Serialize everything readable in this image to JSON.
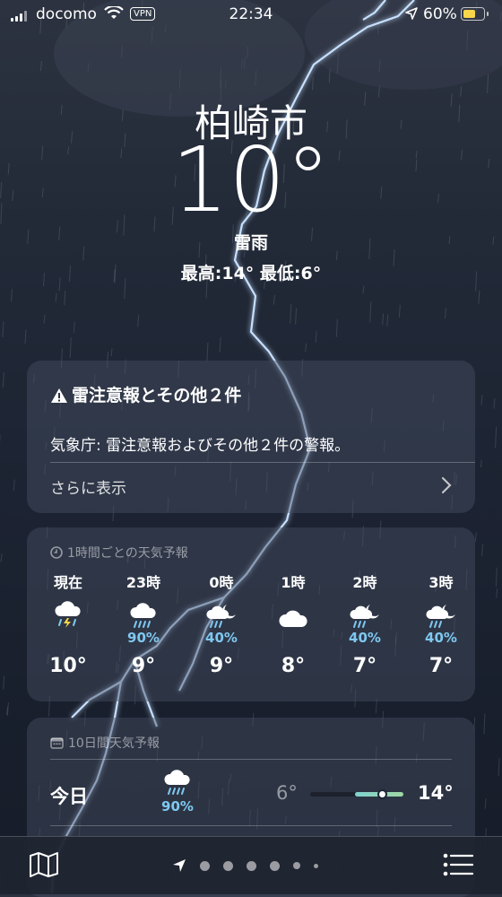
{
  "status_bar": {
    "carrier": "docomo",
    "vpn_label": "VPN",
    "time": "22:34",
    "battery_percent": "60%",
    "battery_level": 0.6,
    "battery_color": "#f7d64a"
  },
  "weather": {
    "city": "柏崎市",
    "temperature": "10°",
    "condition": "雷雨",
    "hi_lo": "最高:14°  最低:6°"
  },
  "alert": {
    "title": "雷注意報とその他２件",
    "body": "気象庁: 雷注意報およびその他２件の警報。",
    "more": "さらに表示"
  },
  "hourly": {
    "header": "1時間ごとの天気予報",
    "items": [
      {
        "label": "現在",
        "icon": "thunderstorm-rain-icon",
        "precip": "",
        "temp": "10°"
      },
      {
        "label": "23時",
        "icon": "cloud-rain-icon",
        "precip": "90%",
        "temp": "9°"
      },
      {
        "label": "0時",
        "icon": "cloud-moon-rain-icon",
        "precip": "40%",
        "temp": "9°"
      },
      {
        "label": "1時",
        "icon": "cloud-icon",
        "precip": "",
        "temp": "8°"
      },
      {
        "label": "2時",
        "icon": "cloud-moon-rain-icon",
        "precip": "40%",
        "temp": "7°"
      },
      {
        "label": "3時",
        "icon": "cloud-moon-rain-icon",
        "precip": "40%",
        "temp": "7°"
      }
    ]
  },
  "daily": {
    "header": "10日間天気予報",
    "today": {
      "day": "今日",
      "icon": "cloud-rain-icon",
      "precip": "90%",
      "low": "6°",
      "high": "14°"
    }
  },
  "colors": {
    "accent_precip": "#7fc8f0",
    "lightning": "#a9c8ff"
  }
}
